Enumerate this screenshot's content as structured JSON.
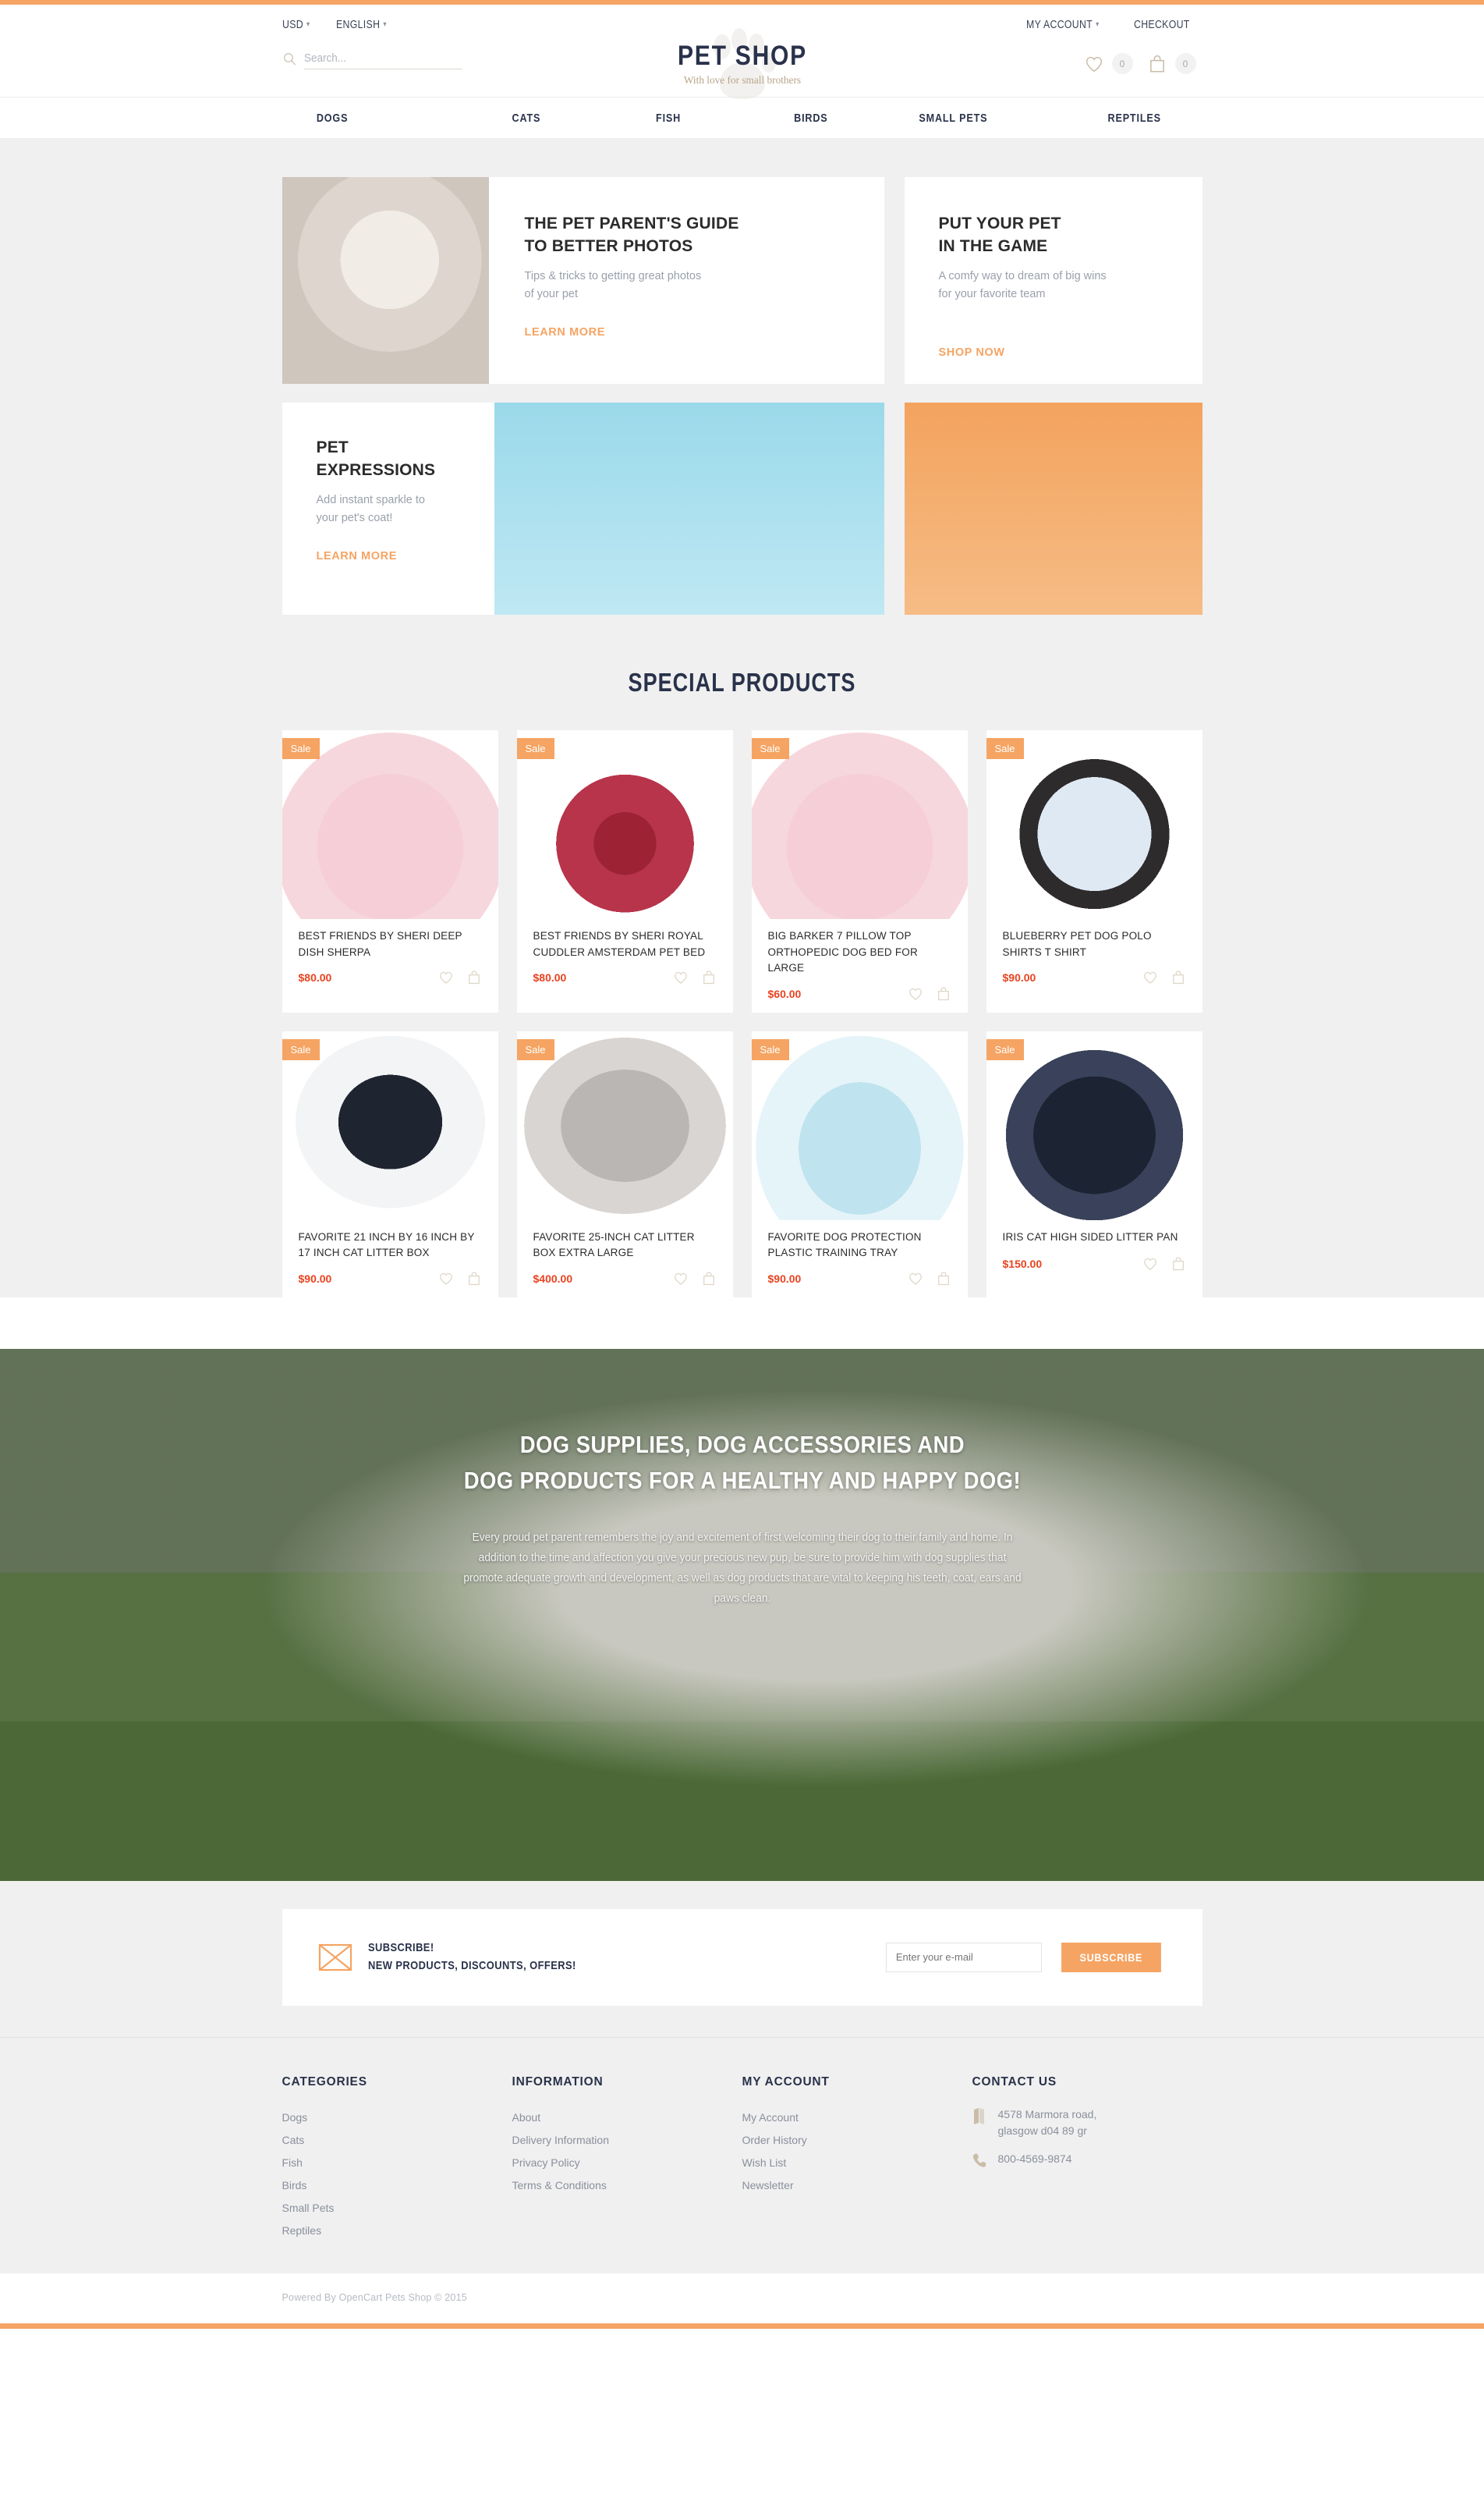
{
  "topbar": {
    "currency": "USD",
    "language": "ENGLISH",
    "my_account": "MY ACCOUNT",
    "checkout": "CHECKOUT"
  },
  "search": {
    "placeholder": "Search..."
  },
  "brand": {
    "title": "PET SHOP",
    "tagline": "With love for small brothers"
  },
  "header_counters": {
    "wishlist": "0",
    "cart": "0"
  },
  "nav": {
    "items": [
      {
        "label": "DOGS"
      },
      {
        "label": "CATS"
      },
      {
        "label": "FISH"
      },
      {
        "label": "BIRDS"
      },
      {
        "label": "SMALL PETS"
      },
      {
        "label": "REPTILES"
      }
    ]
  },
  "banners": {
    "guide": {
      "title_l1": "THE PET PARENT'S GUIDE",
      "title_l2": "TO BETTER PHOTOS",
      "text_l1": "Tips & tricks to getting great photos",
      "text_l2": "of your pet",
      "cta": "LEARN MORE"
    },
    "game": {
      "title_l1": "PUT YOUR PET",
      "title_l2": "IN THE GAME",
      "text_l1": "A comfy way to dream of big wins",
      "text_l2": "for your favorite team",
      "cta": "SHOP NOW"
    },
    "expressions": {
      "title_l1": "PET",
      "title_l2": "EXPRESSIONS",
      "text_l1": "Add instant sparkle to",
      "text_l2": "your pet's coat!",
      "cta": "LEARN MORE"
    }
  },
  "special_products": {
    "heading": "SPECIAL PRODUCTS",
    "badge_label": "Sale",
    "items": [
      {
        "name": "BEST FRIENDS BY SHERI DEEP DISH SHERPA",
        "price": "$80.00",
        "image": "ph-pinkbed"
      },
      {
        "name": "BEST FRIENDS BY SHERI ROYAL CUDDLER AMSTERDAM PET BED",
        "price": "$80.00",
        "image": "ph-redbed"
      },
      {
        "name": "BIG BARKER 7 PILLOW TOP ORTHOPEDIC DOG BED FOR LARGE",
        "price": "$60.00",
        "image": "ph-pinkbed"
      },
      {
        "name": "BLUEBERRY PET DOG POLO SHIRTS T SHIRT",
        "price": "$90.00",
        "image": "ph-shirt"
      },
      {
        "name": "FAVORITE 21 INCH BY 16 INCH BY 17 INCH CAT LITTER BOX",
        "price": "$90.00",
        "image": "ph-litter1"
      },
      {
        "name": "FAVORITE 25-INCH CAT LITTER BOX EXTRA LARGE",
        "price": "$400.00",
        "image": "ph-litter2"
      },
      {
        "name": "FAVORITE DOG PROTECTION PLASTIC TRAINING TRAY",
        "price": "$90.00",
        "image": "ph-tray"
      },
      {
        "name": "IRIS CAT HIGH SIDED LITTER PAN",
        "price": "$150.00",
        "image": "ph-pan"
      }
    ]
  },
  "hero": {
    "title_l1": "DOG SUPPLIES, DOG ACCESSORIES AND",
    "title_l2": "DOG PRODUCTS FOR A HEALTHY AND HAPPY DOG!",
    "paragraph": "Every proud pet parent remembers the joy and excitement of first welcoming their dog to their family and home. In addition to the time and affection you give your precious new pup, be sure to provide him with dog supplies that promote adequate growth and development, as well as dog products that are vital to keeping his teeth, coat, ears and paws clean."
  },
  "subscribe": {
    "line1": "SUBSCRIBE!",
    "line2": "NEW PRODUCTS, DISCOUNTS, OFFERS!",
    "placeholder": "Enter your e-mail",
    "button": "SUBSCRIBE"
  },
  "footer": {
    "categories": {
      "heading": "CATEGORIES",
      "links": [
        "Dogs",
        "Cats",
        "Fish",
        "Birds",
        "Small Pets",
        "Reptiles"
      ]
    },
    "information": {
      "heading": "INFORMATION",
      "links": [
        "About",
        "Delivery Information",
        "Privacy Policy",
        "Terms & Conditions"
      ]
    },
    "my_account": {
      "heading": "MY ACCOUNT",
      "links": [
        "My Account",
        "Order History",
        "Wish List",
        "Newsletter"
      ]
    },
    "contact": {
      "heading": "CONTACT US",
      "address_l1": "4578 Marmora road,",
      "address_l2": "glasgow d04 89 gr",
      "phone": "800-4569-9874"
    }
  },
  "copyright": "Powered By OpenCart Pets Shop © 2015",
  "colors": {
    "accent": "#f5a463",
    "price": "#e8431f",
    "dark": "#29324a",
    "muted": "#8a8f9c",
    "page_bg": "#f0f0f0"
  }
}
